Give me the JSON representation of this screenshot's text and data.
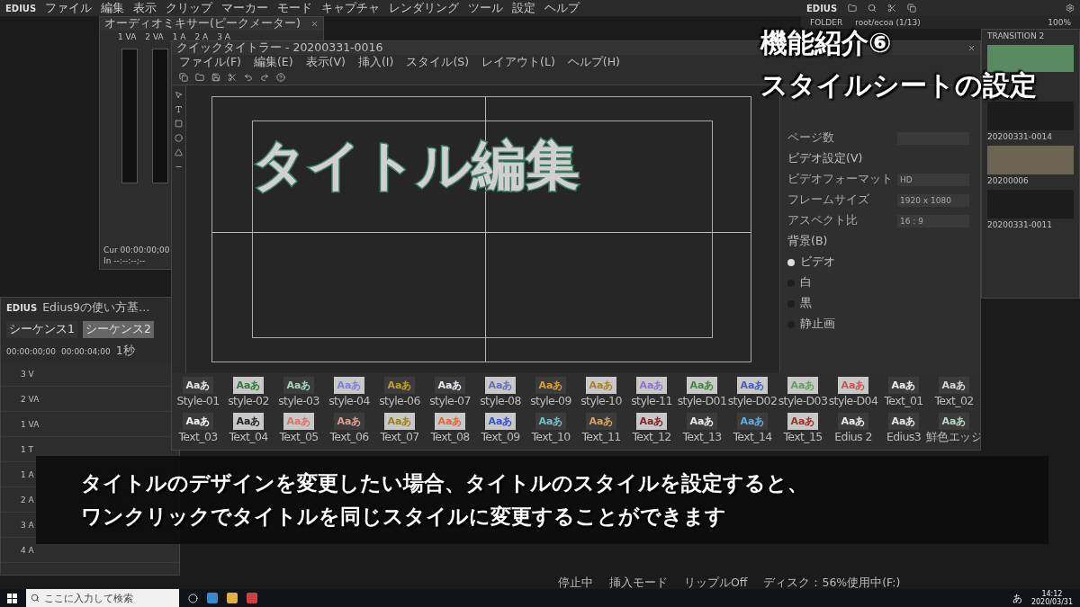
{
  "menubar": {
    "logo": "EDIUS",
    "items": [
      "ファイル",
      "編集",
      "表示",
      "クリップ",
      "マーカー",
      "モード",
      "キャプチャ",
      "レンダリング",
      "ツール",
      "設定",
      "ヘルプ"
    ]
  },
  "mixer": {
    "title": "オーディオミキサー(ピークメーター)",
    "channels": [
      "1 VA",
      "2 VA",
      "1 A",
      "2 A",
      "3 A"
    ],
    "cur": "Cur 00:00:00;00",
    "in": "In --:--:--;--"
  },
  "titler": {
    "title": "クイックタイトラー - 20200331-0016",
    "menu": [
      "ファイル(F)",
      "編集(E)",
      "表示(V)",
      "挿入(I)",
      "スタイル(S)",
      "レイアウト(L)",
      "ヘルプ(H)"
    ],
    "canvas_text": "タイトル編集",
    "properties": {
      "page_label": "ページ数",
      "video_heading": "ビデオ設定(V)",
      "fields": [
        {
          "label": "ビデオフォーマット",
          "value": "HD"
        },
        {
          "label": "フレームサイズ",
          "value": "1920 x 1080"
        },
        {
          "label": "アスペクト比",
          "value": "16 : 9"
        }
      ],
      "background_heading": "背景(B)",
      "options": [
        {
          "label": "ビデオ",
          "selected": true
        },
        {
          "label": "白",
          "selected": false
        },
        {
          "label": "黒",
          "selected": false
        },
        {
          "label": "静止画",
          "selected": false
        }
      ]
    },
    "styles": [
      {
        "label": "Style-01",
        "sample": "Aaあ",
        "color": "#e8e8e8"
      },
      {
        "label": "style-02",
        "sample": "Aaあ",
        "color": "#2e7d32"
      },
      {
        "label": "style-03",
        "sample": "Aaあ",
        "color": "#a8d8c0"
      },
      {
        "label": "style-04",
        "sample": "Aaあ",
        "color": "#8080e0"
      },
      {
        "label": "style-06",
        "sample": "Aaあ",
        "color": "#c8a020"
      },
      {
        "label": "style-07",
        "sample": "Aaあ",
        "color": "#f0f0f8"
      },
      {
        "label": "style-08",
        "sample": "Aaあ",
        "color": "#6070c0"
      },
      {
        "label": "style-09",
        "sample": "Aaあ",
        "color": "#e0a030"
      },
      {
        "label": "style-10",
        "sample": "Aaあ",
        "color": "#b08020"
      },
      {
        "label": "style-11",
        "sample": "Aaあ",
        "color": "#9070d0"
      },
      {
        "label": "style-D01",
        "sample": "Aaあ",
        "color": "#3a8a3a"
      },
      {
        "label": "style-D02",
        "sample": "Aaあ",
        "color": "#4060c0"
      },
      {
        "label": "style-D03",
        "sample": "Aaあ",
        "color": "#60a060"
      },
      {
        "label": "style-D04",
        "sample": "Aaあ",
        "color": "#d05050"
      },
      {
        "label": "Text_01",
        "sample": "Aaあ",
        "color": "#f4f4f4"
      },
      {
        "label": "Text_02",
        "sample": "Aaあ",
        "color": "#d8d8d8"
      },
      {
        "label": "Text_03",
        "sample": "Aaあ",
        "color": "#ffffff"
      },
      {
        "label": "Text_04",
        "sample": "Aaあ",
        "color": "#202020"
      },
      {
        "label": "Text_05",
        "sample": "Aaあ",
        "color": "#e07060"
      },
      {
        "label": "Text_06",
        "sample": "Aaあ",
        "color": "#e0a090"
      },
      {
        "label": "Text_07",
        "sample": "Aaあ",
        "color": "#a08010"
      },
      {
        "label": "Text_08",
        "sample": "Aaあ",
        "color": "#f06030"
      },
      {
        "label": "Text_09",
        "sample": "Aaあ",
        "color": "#3050e0"
      },
      {
        "label": "Text_10",
        "sample": "Aaあ",
        "color": "#70c0d0"
      },
      {
        "label": "Text_11",
        "sample": "Aaあ",
        "color": "#e0a060"
      },
      {
        "label": "Text_12",
        "sample": "Aaあ",
        "color": "#802020"
      },
      {
        "label": "Text_13",
        "sample": "Aaあ",
        "color": "#f0f0f0"
      },
      {
        "label": "Text_14",
        "sample": "Aaあ",
        "color": "#60b0e0"
      },
      {
        "label": "Text_15",
        "sample": "Aaあ",
        "color": "#a03020"
      },
      {
        "label": "Edius 2",
        "sample": "Aaあ",
        "color": "#f0f0f0"
      },
      {
        "label": "Edius3",
        "sample": "Aaあ",
        "color": "#e8e8e8"
      },
      {
        "label": "鮮色エッジ",
        "sample": "Aaあ",
        "color": "#b8d8c8"
      }
    ]
  },
  "bin": {
    "logo": "EDIUS",
    "folder": "FOLDER",
    "path": "root/ecoa (1/13)",
    "zoom": "100%",
    "clips": [
      "TRANSITION 2",
      "20200331-0014",
      "20200006",
      "20200331-0011"
    ]
  },
  "timeline": {
    "logo": "EDIUS",
    "project": "Edius9の使い方基…",
    "tabs": [
      {
        "label": "シーケンス1",
        "selected": false
      },
      {
        "label": "シーケンス2",
        "selected": true
      }
    ],
    "times": [
      "00:00:00;00",
      "00:00:04;00"
    ],
    "scale": "1秒",
    "tracks": [
      "3 V",
      "2 VA",
      "1 VA",
      "1 T",
      "1 A",
      "2 A",
      "3 A",
      "4 A"
    ]
  },
  "status_bar": [
    "停止中",
    "挿入モード",
    "リップルOff",
    "ディスク：56%使用中(F:)"
  ],
  "headline": [
    "機能紹介⑥",
    "スタイルシートの設定"
  ],
  "subtitle": [
    "タイトルのデザインを変更したい場合、タイトルのスタイルを設定すると、",
    "ワンクリックでタイトルを同じスタイルに変更することができます"
  ],
  "taskbar": {
    "search_placeholder": "ここに入力して検索",
    "ime": "あ",
    "time": "14:12",
    "date": "2020/03/31"
  }
}
